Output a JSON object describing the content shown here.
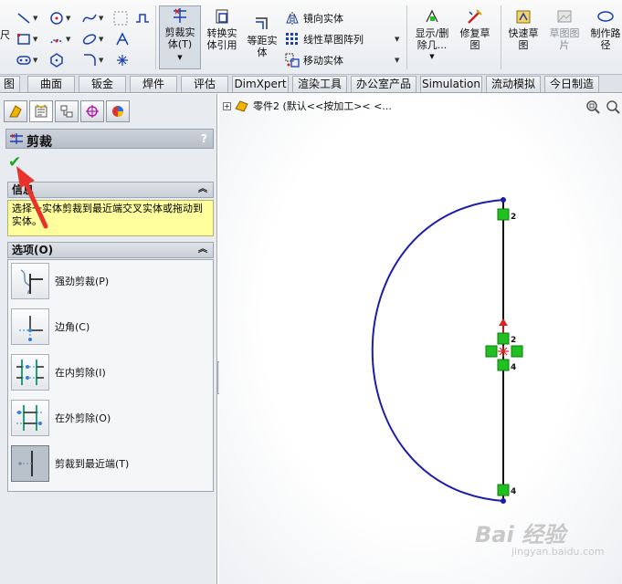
{
  "toolbar": {
    "trim_label": "剪裁实\n体(T)",
    "convert_label": "转换实\n体引用",
    "offset_label": "等距实\n体",
    "mirror_label": "镜向实体",
    "linear_pattern_label": "线性草图阵列",
    "move_label": "移动实体",
    "show_delete_label": "显示/删\n除几...",
    "repair_label": "修复草\n图",
    "quick_snap_label": "快速草\n图",
    "sketch_picture_label": "草图图\n片",
    "make_path_label": "制作路\n径",
    "left_cut_label": "尺"
  },
  "tabs": [
    {
      "label": "图"
    },
    {
      "label": "曲面"
    },
    {
      "label": "钣金"
    },
    {
      "label": "焊件"
    },
    {
      "label": "评估"
    },
    {
      "label": "DimXpert"
    },
    {
      "label": "渲染工具"
    },
    {
      "label": "办公室产品"
    },
    {
      "label": "Simulation"
    },
    {
      "label": "流动模拟"
    },
    {
      "label": "今日制造"
    }
  ],
  "property_manager": {
    "title": "剪裁",
    "help": "?",
    "info_header": "信息",
    "info_text": "选择一实体剪裁到最近端交叉实体或拖动到实体。",
    "options_header": "选项(O)",
    "options": [
      {
        "label": "强劲剪裁(P)",
        "icon": "power-trim-icon"
      },
      {
        "label": "边角(C)",
        "icon": "corner-trim-icon"
      },
      {
        "label": "在内剪除(I)",
        "icon": "trim-inside-icon"
      },
      {
        "label": "在外剪除(O)",
        "icon": "trim-outside-icon"
      },
      {
        "label": "剪裁到最近端(T)",
        "icon": "trim-closest-icon"
      }
    ]
  },
  "tree": {
    "part_name": "零件2  (默认<<按加工>< <..."
  },
  "sketch": {
    "label_top": "2",
    "label_mid_top": "2",
    "label_mid_bottom": "4",
    "label_bottom": "4"
  },
  "watermark": {
    "brand": "Bai 经验",
    "url": "jingyan.baidu.com"
  },
  "colors": {
    "arc": "#1b1ea8",
    "line": "#111111",
    "relation": "#21c021",
    "arrow": "#e8322b"
  }
}
